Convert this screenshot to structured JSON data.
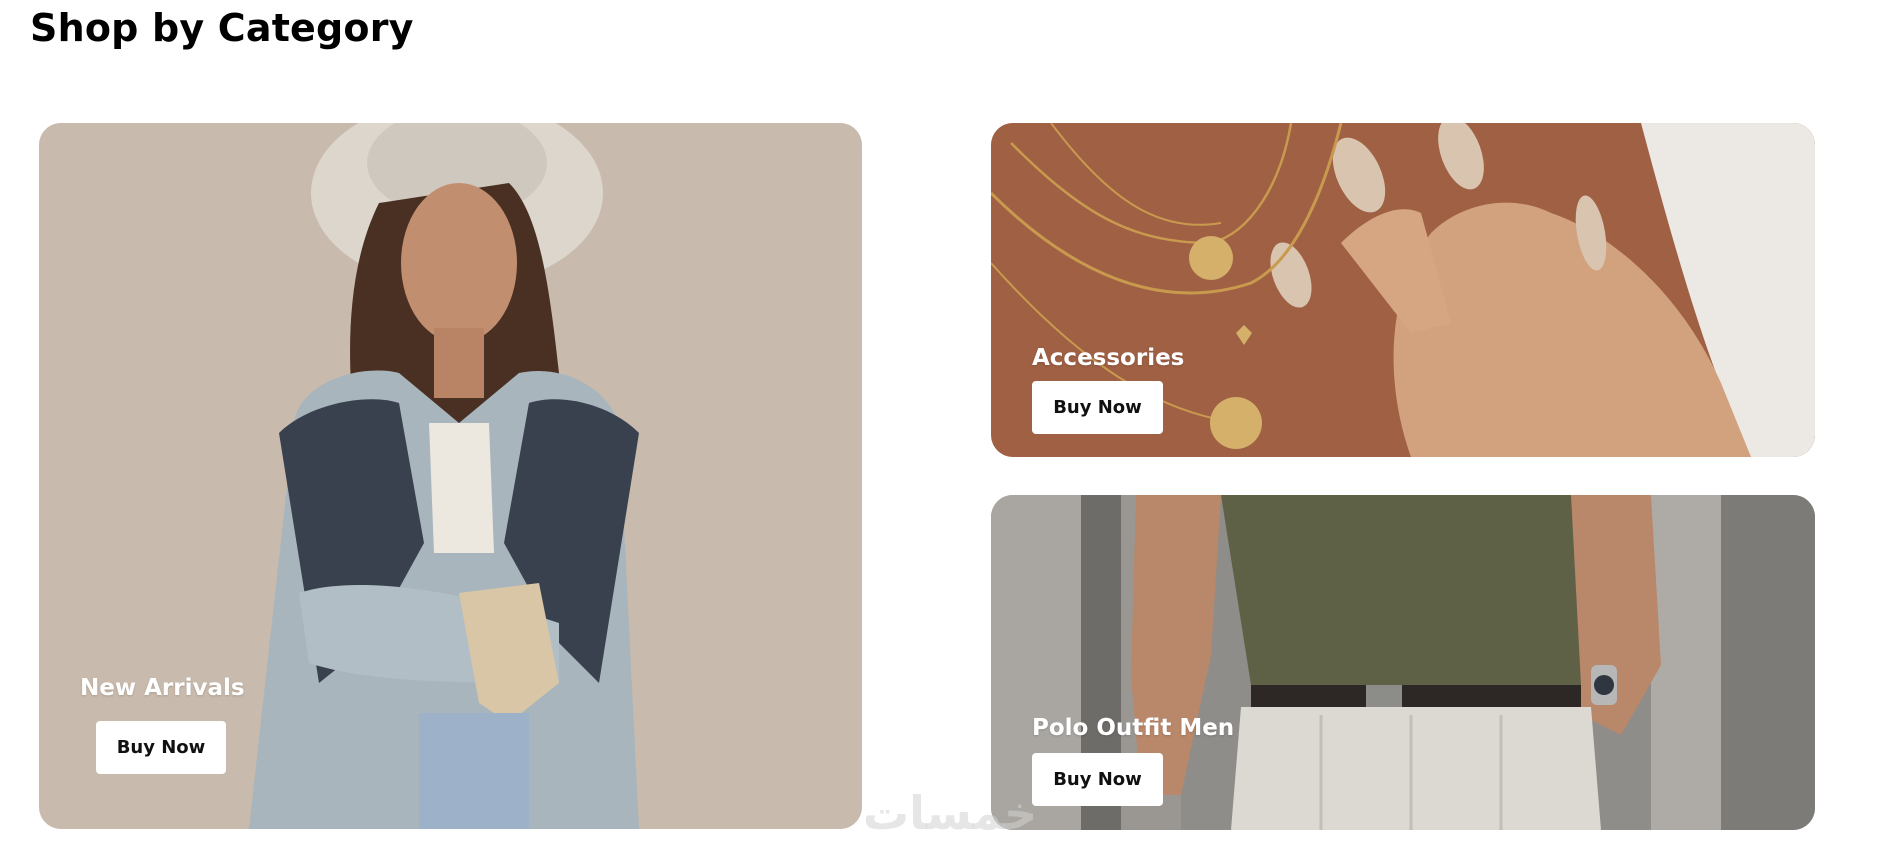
{
  "page": {
    "title": "Shop by Category"
  },
  "categories": [
    {
      "title": "New Arrivals",
      "button": "Buy Now"
    },
    {
      "title": "Accessories",
      "button": "Buy Now"
    },
    {
      "title": "Polo Outfit Men",
      "button": "Buy Now"
    }
  ],
  "watermark": {
    "text": "خمسات"
  },
  "colors": {
    "button_bg": "#ffffff",
    "button_text": "#111111",
    "card_title": "#ffffff"
  }
}
